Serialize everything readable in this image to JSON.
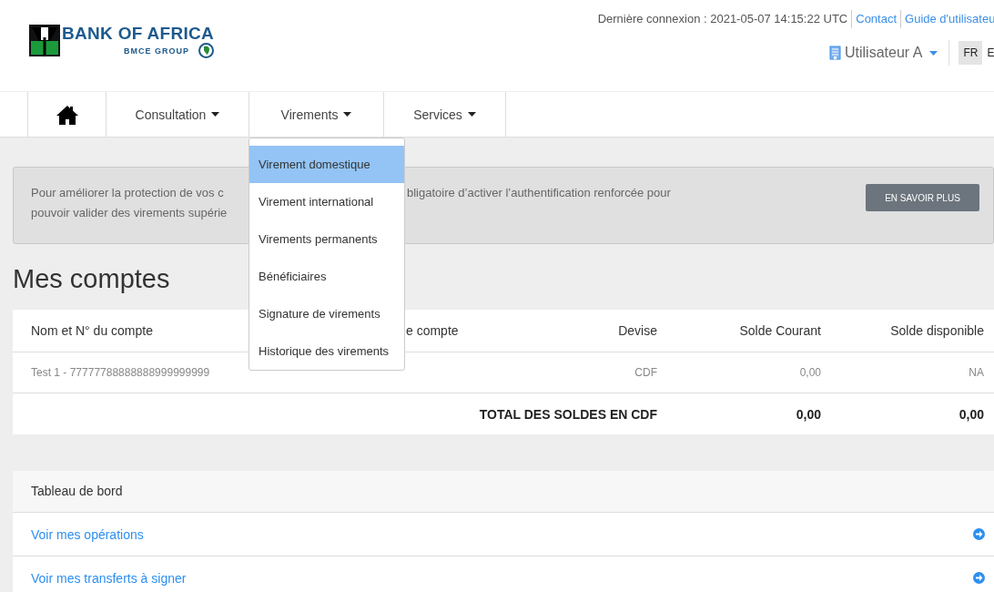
{
  "header": {
    "logo": {
      "name": "BANK OF AFRICA",
      "group": "BMCE GROUP"
    },
    "last_login": "Dernière connexion : 2021-05-07 14:15:22 UTC",
    "links": [
      "Contact",
      "Guide d'utilisateu"
    ],
    "user": "Utilisateur A",
    "languages": [
      {
        "label": "FR",
        "selected": true
      },
      {
        "label": "E",
        "selected": false
      }
    ]
  },
  "nav": {
    "items": [
      {
        "kind": "home"
      },
      {
        "kind": "menu",
        "label": "Consultation"
      },
      {
        "kind": "menu",
        "label": "Virements"
      },
      {
        "kind": "menu",
        "label": "Services"
      }
    ],
    "dropdown": [
      {
        "label": "Virement domestique",
        "selected": true
      },
      {
        "label": "Virement international",
        "selected": false
      },
      {
        "label": "Virements permanents",
        "selected": false
      },
      {
        "label": "Bénéficiaires",
        "selected": false
      },
      {
        "label": "Signature de virements",
        "selected": false
      },
      {
        "label": "Historique des virements",
        "selected": false
      }
    ]
  },
  "banner": {
    "text_parts": [
      "Pour améliorer la protection de vos c",
      "bligatoire d’activer l’authentification renforcée pour",
      "pouvoir valider des virements supérie"
    ],
    "button": "EN SAVOIR PLUS"
  },
  "accounts": {
    "title": "Mes comptes",
    "columns": [
      "Nom et N° du compte",
      "e compte",
      "Devise",
      "Solde Courant",
      "Solde disponible"
    ],
    "rows": [
      [
        "Test 1 - 77777788888888999999999",
        "",
        "CDF",
        "0,00",
        "NA"
      ]
    ],
    "total": {
      "label": "TOTAL DES SOLDES EN CDF",
      "current": "0,00",
      "available": "0,00"
    }
  },
  "dashboard": {
    "title": "Tableau de bord",
    "links": [
      "Voir mes opérations",
      "Voir mes transferts à signer"
    ]
  }
}
